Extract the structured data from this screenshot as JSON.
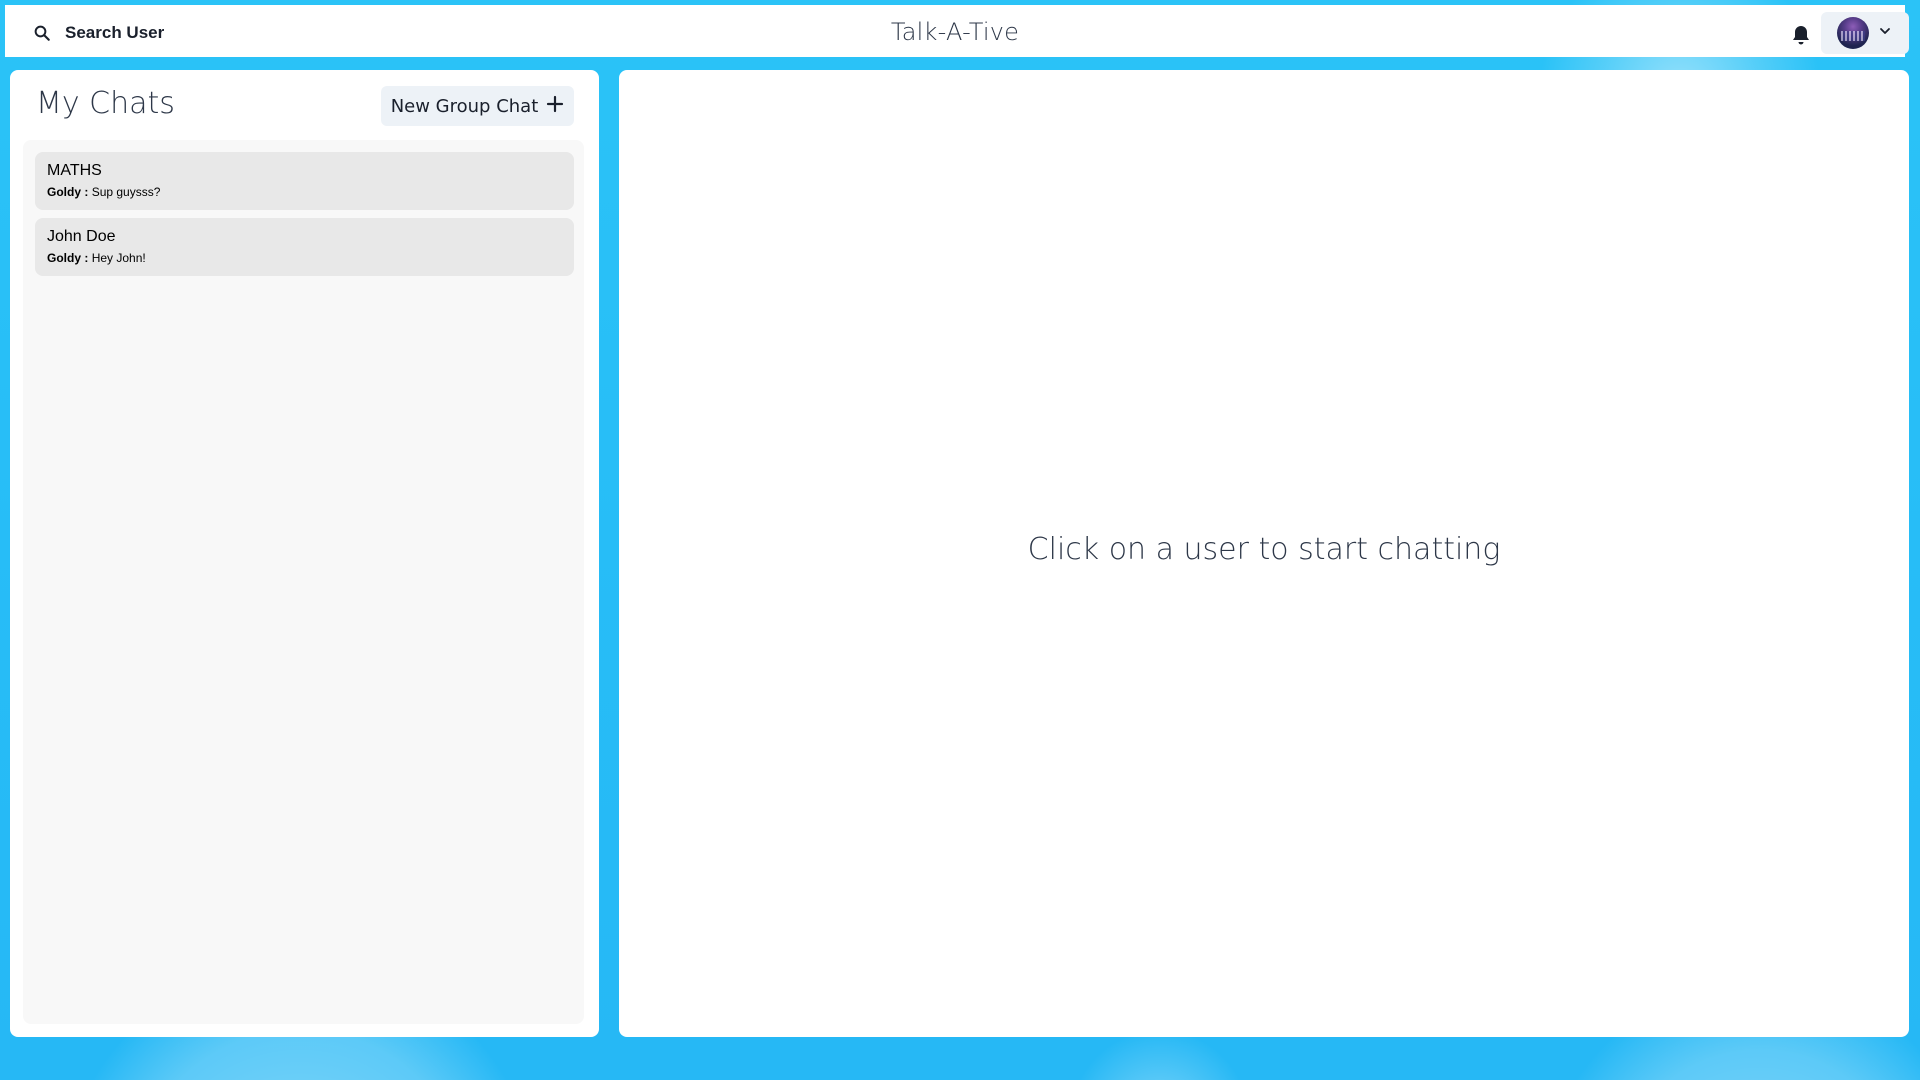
{
  "header": {
    "search_label": "Search User",
    "app_title": "Talk-A-Tive"
  },
  "chats": {
    "title": "My Chats",
    "new_group_label": "New Group Chat",
    "items": [
      {
        "name": "MATHS",
        "sender": "Goldy :",
        "message": "Sup guysss?"
      },
      {
        "name": "John Doe",
        "sender": "Goldy :",
        "message": "Hey John!"
      }
    ]
  },
  "chat_box": {
    "placeholder": "Click on a user to start chatting"
  },
  "colors": {
    "background": "#29c0f7",
    "panel": "#ffffff",
    "chat_item": "#e8e8e8",
    "button": "#edf2f7",
    "text": "#2d3748"
  },
  "icons": {
    "search": "search-icon",
    "bell": "bell-icon",
    "plus": "plus-icon",
    "chevron": "chevron-down-icon"
  }
}
